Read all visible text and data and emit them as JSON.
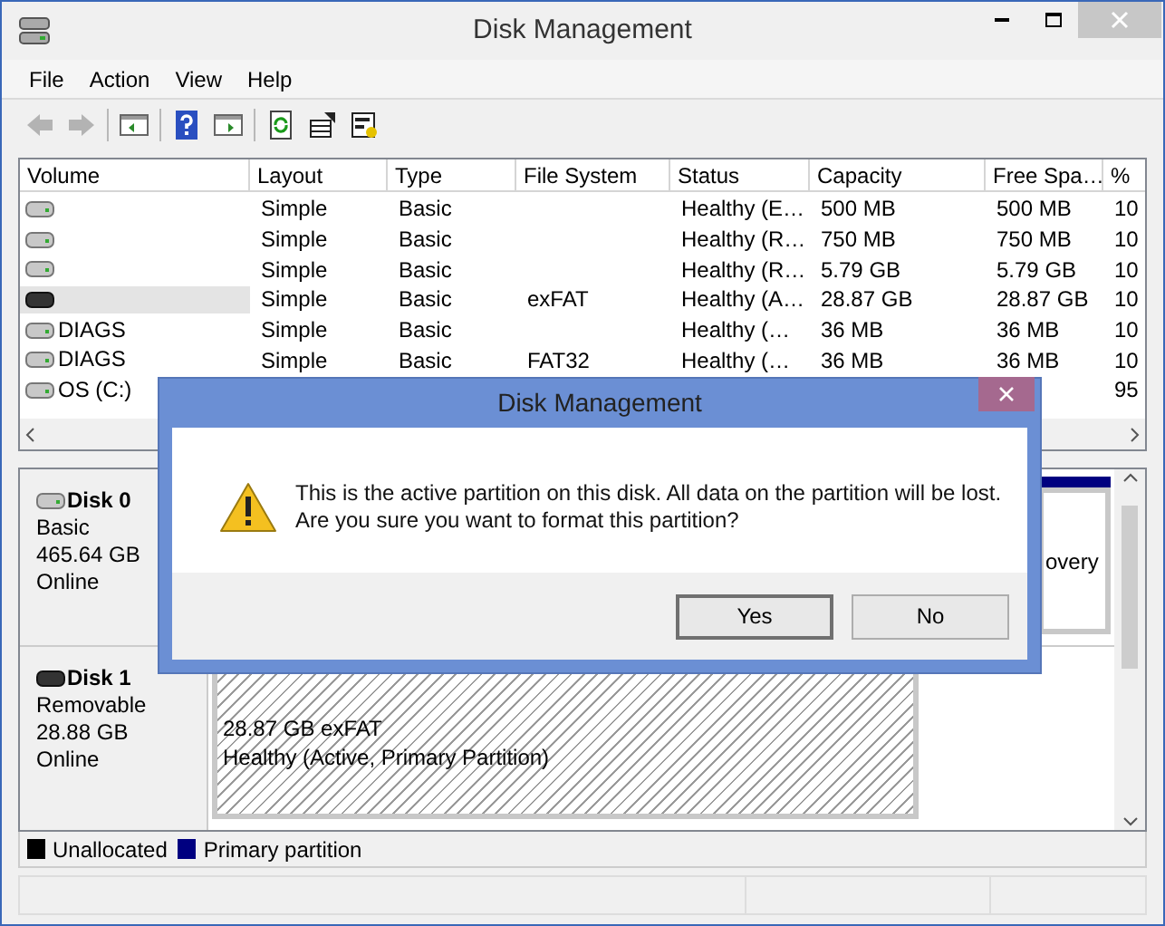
{
  "window": {
    "title": "Disk Management"
  },
  "menu": [
    "File",
    "Action",
    "View",
    "Help"
  ],
  "toolbar": [
    {
      "kind": "back",
      "disabled": true
    },
    {
      "kind": "forward",
      "disabled": true
    },
    {
      "kind": "pane-left",
      "disabled": false
    },
    {
      "kind": "help",
      "disabled": false
    },
    {
      "kind": "pane-right",
      "disabled": false
    },
    {
      "kind": "refresh",
      "disabled": false
    },
    {
      "kind": "properties",
      "disabled": false
    },
    {
      "kind": "settings",
      "disabled": false
    }
  ],
  "table": {
    "columns": [
      "Volume",
      "Layout",
      "Type",
      "File System",
      "Status",
      "Capacity",
      "Free Spa…",
      "%"
    ],
    "rows": [
      {
        "kind": "fixed",
        "selected": false,
        "cells": [
          "",
          "Simple",
          "Basic",
          "",
          "Healthy (E…",
          "500 MB",
          "500 MB",
          "10"
        ]
      },
      {
        "kind": "fixed",
        "selected": false,
        "cells": [
          "",
          "Simple",
          "Basic",
          "",
          "Healthy (R…",
          "750 MB",
          "750 MB",
          "10"
        ]
      },
      {
        "kind": "fixed",
        "selected": false,
        "cells": [
          "",
          "Simple",
          "Basic",
          "",
          "Healthy (R…",
          "5.79 GB",
          "5.79 GB",
          "10"
        ]
      },
      {
        "kind": "removable",
        "selected": true,
        "cells": [
          "",
          "Simple",
          "Basic",
          "exFAT",
          "Healthy (A…",
          "28.87 GB",
          "28.87 GB",
          "10"
        ]
      },
      {
        "kind": "fixed",
        "selected": false,
        "cells": [
          "DIAGS",
          "Simple",
          "Basic",
          "",
          "Healthy (…",
          "36 MB",
          "36 MB",
          "10"
        ]
      },
      {
        "kind": "fixed",
        "selected": false,
        "cells": [
          "DIAGS",
          "Simple",
          "Basic",
          "FAT32",
          "Healthy (…",
          "36 MB",
          "36 MB",
          "10"
        ]
      },
      {
        "kind": "fixed",
        "selected": false,
        "cells": [
          "OS (C:)",
          "",
          "",
          "",
          "",
          "",
          "",
          "95"
        ]
      }
    ]
  },
  "disks": [
    {
      "kind": "fixed",
      "name": "Disk 0",
      "type": "Basic",
      "size": "465.64 GB",
      "status": "Online",
      "partitions": [
        {
          "label": "overy",
          "hatched": false
        }
      ]
    },
    {
      "kind": "removable",
      "name": "Disk 1",
      "type": "Removable",
      "size": "28.88 GB",
      "status": "Online",
      "partitions": [
        {
          "size": "28.87 GB exFAT",
          "status": "Healthy (Active, Primary Partition)",
          "hatched": true
        }
      ]
    }
  ],
  "legend": [
    {
      "label": "Unallocated",
      "color": "#000000"
    },
    {
      "label": "Primary partition",
      "color": "#000080"
    }
  ],
  "dialog": {
    "title": "Disk Management",
    "message": "This is the active partition on this disk. All data on the partition will be lost. Are you sure you want to format this partition?",
    "buttons": [
      {
        "label": "Yes",
        "default": true
      },
      {
        "label": "No",
        "default": false
      }
    ]
  }
}
